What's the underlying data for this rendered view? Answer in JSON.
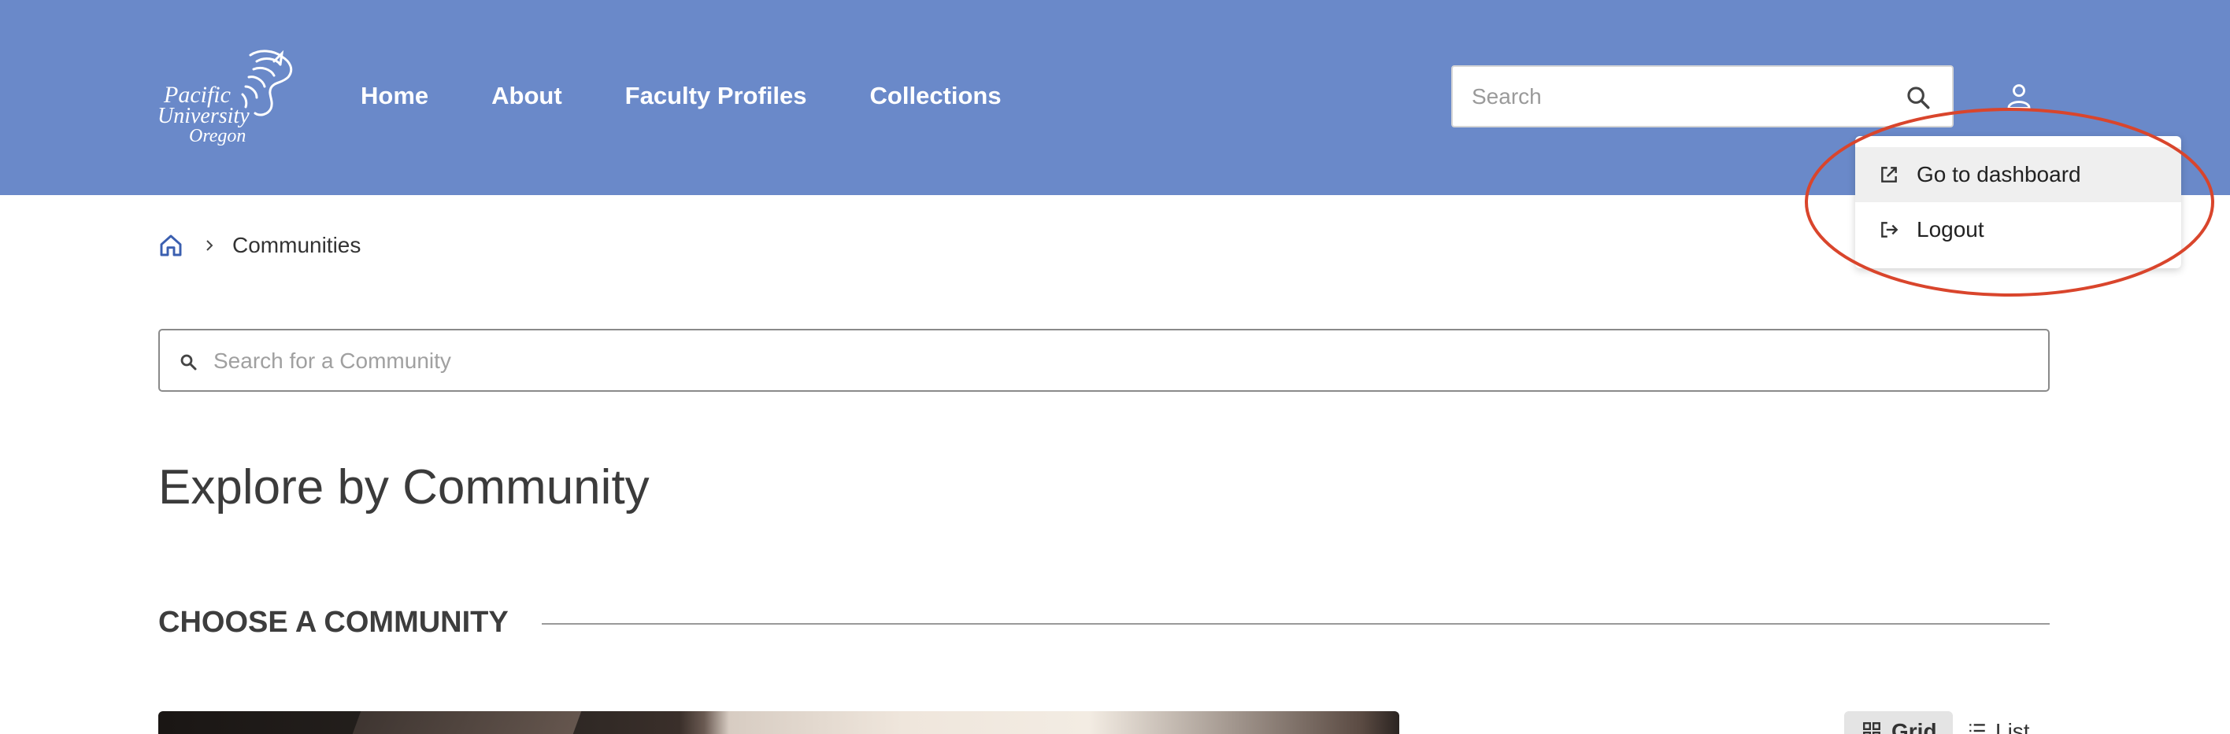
{
  "header": {
    "logo": {
      "line1": "Pacific",
      "line2": "University",
      "line3": "Oregon",
      "icon": "boxer-crest-icon"
    },
    "nav": [
      {
        "label": "Home"
      },
      {
        "label": "About"
      },
      {
        "label": "Faculty Profiles"
      },
      {
        "label": "Collections"
      }
    ],
    "search": {
      "placeholder": "Search",
      "icon": "search-icon"
    },
    "user_icon": "user-icon",
    "background_color": "#6a89c9"
  },
  "user_menu": {
    "items": [
      {
        "label": "Go to dashboard",
        "icon": "external-link-icon",
        "highlighted": true
      },
      {
        "label": "Logout",
        "icon": "logout-icon",
        "highlighted": false
      }
    ],
    "annotation_color": "#d9452c"
  },
  "breadcrumb": {
    "home_icon": "home-icon",
    "items": [
      {
        "label": "Communities"
      }
    ]
  },
  "community_search": {
    "placeholder": "Search for a Community",
    "icon": "search-icon"
  },
  "page_title": "Explore by Community",
  "section": {
    "heading": "CHOOSE A COMMUNITY"
  },
  "view_toggle": {
    "grid_label": "Grid",
    "list_label": "List",
    "selected": "Grid"
  }
}
